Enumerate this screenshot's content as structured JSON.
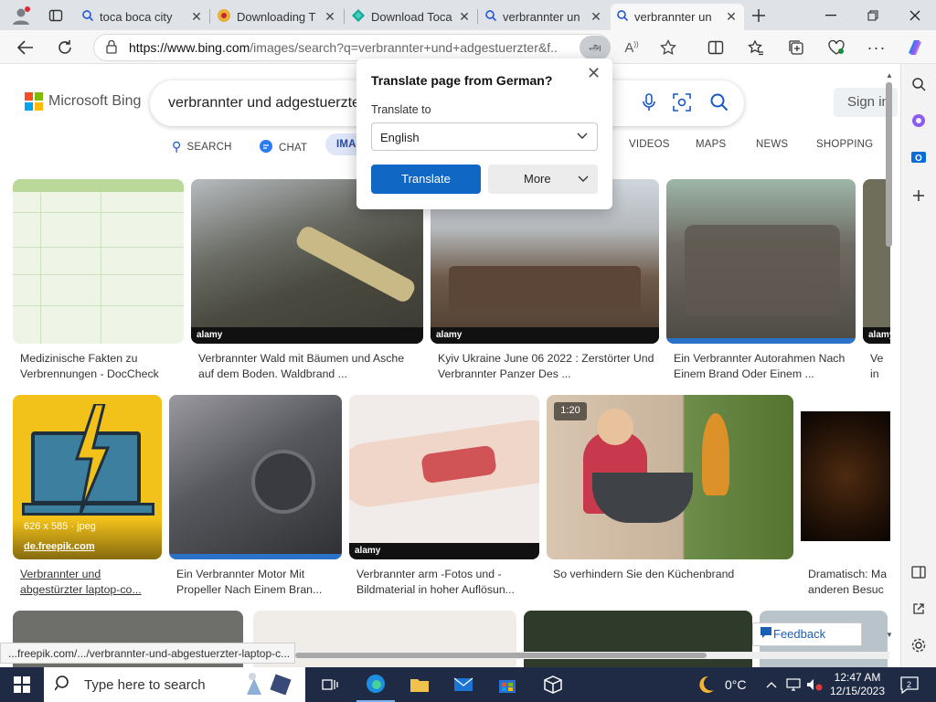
{
  "tabs": [
    {
      "title": "toca boca city",
      "icon": "search-icon"
    },
    {
      "title": "Downloading T",
      "icon": "download-site-icon"
    },
    {
      "title": "Download Toca",
      "icon": "diamond-site-icon"
    },
    {
      "title": "verbrannter un",
      "icon": "search-icon"
    },
    {
      "title": "verbrannter un",
      "icon": "search-icon",
      "active": true
    }
  ],
  "address": {
    "host": "https://www.bing.com",
    "path": "/images/search?q=verbrannter+und+adgestuerzter&f..."
  },
  "bing": {
    "logo": "Microsoft Bing",
    "query": "verbrannter und adgestuerzter",
    "signin": "Sign in",
    "nav": [
      "SEARCH",
      "CHAT",
      "IMAGES",
      "VIDEOS",
      "MAPS",
      "NEWS",
      "SHOPPING"
    ]
  },
  "translate_popup": {
    "title": "Translate page from German?",
    "label": "Translate to",
    "language": "English",
    "translate_btn": "Translate",
    "more_btn": "More"
  },
  "results": [
    {
      "caption": [
        "Medizinische Fakten zu",
        "Verbrennungen - DocCheck"
      ]
    },
    {
      "caption": [
        "Verbrannter Wald mit Bäumen und Asche",
        "auf dem Boden. Waldbrand ..."
      ],
      "watermark": "alamy"
    },
    {
      "caption": [
        "Kyiv Ukraine June 06 2022 : Zerstörter Und",
        "Verbrannter Panzer Des ..."
      ],
      "watermark": "alamy"
    },
    {
      "caption": [
        "Ein Verbrannter Autorahmen Nach",
        "Einem Brand Oder Einem ..."
      ]
    },
    {
      "caption": [
        "Ve",
        "in"
      ],
      "watermark": "alamy"
    },
    {
      "caption": [
        "Verbrannter und",
        "abgestürzter laptop-co..."
      ],
      "dims": "626 x 585 · jpeg",
      "source": "de.freepik.com"
    },
    {
      "caption": [
        "Ein Verbrannter Motor Mit",
        "Propeller Nach Einem Bran..."
      ]
    },
    {
      "caption": [
        "Verbrannter arm -Fotos und -",
        "Bildmaterial in hoher Auflösun..."
      ],
      "watermark": "alamy"
    },
    {
      "caption": [
        "So verhindern Sie den Küchenbrand"
      ],
      "duration": "1:20"
    },
    {
      "caption": [
        "Dramatisch: Ma",
        "anderen Besuc"
      ]
    }
  ],
  "feedback": "Feedback",
  "status_url": "...freepik.com/.../verbrannter-und-abgestuerzter-laptop-c...",
  "taskbar": {
    "search_placeholder": "Type here to search",
    "weather": "0°C",
    "time": "12:47 AM",
    "date": "12/15/2023",
    "notifications": "2"
  },
  "colors": {
    "bing_blue": "#1167c4",
    "taskbar": "#1f2a44"
  }
}
